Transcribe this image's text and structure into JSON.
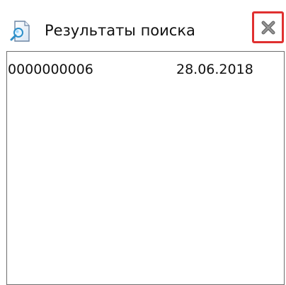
{
  "header": {
    "icon": "search-icon",
    "title": "Результаты поиска",
    "close_icon": "close-icon"
  },
  "results": {
    "rows": [
      {
        "number": "0000000006",
        "date": "28.06.2018"
      }
    ]
  },
  "colors": {
    "close_highlight": "#e03030",
    "border": "#6e6e6e",
    "text": "#111111"
  }
}
